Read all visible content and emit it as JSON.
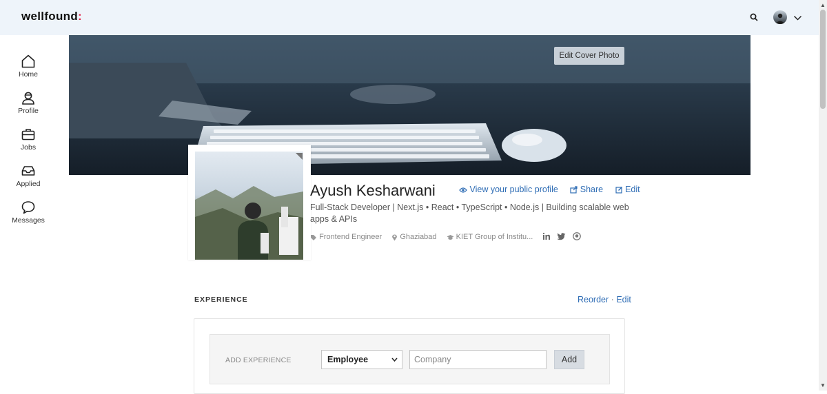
{
  "header": {
    "logo_text": "wellfound",
    "logo_accent": ":",
    "accent_color": "#e0264a",
    "icons": [
      "search-icon",
      "avatar",
      "chevron-down-icon"
    ]
  },
  "sidebar": {
    "items": [
      {
        "label": "Home",
        "icon": "home-icon"
      },
      {
        "label": "Profile",
        "icon": "user-icon"
      },
      {
        "label": "Jobs",
        "icon": "briefcase-icon"
      },
      {
        "label": "Applied",
        "icon": "inbox-icon"
      },
      {
        "label": "Messages",
        "icon": "chat-bubble-icon"
      }
    ]
  },
  "cover": {
    "edit_label": "Edit Cover Photo"
  },
  "profile": {
    "name": "Ayush Kesharwani",
    "view_public": "View your public profile",
    "share": "Share",
    "edit": "Edit",
    "headline": "Full-Stack Developer | Next.js • React • TypeScript • Node.js | Building scalable web apps & APIs",
    "role": "Frontend Engineer",
    "location": "Ghaziabad",
    "education": "KIET Group of Institu...",
    "social_icons": [
      "linkedin-icon",
      "twitter-icon",
      "github-icon"
    ],
    "link_color": "#2f6db5"
  },
  "experience": {
    "title": "EXPERIENCE",
    "reorder": "Reorder",
    "separator": "·",
    "edit": "Edit",
    "add_label": "ADD EXPERIENCE",
    "employment_type": "Employee",
    "company_placeholder": "Company",
    "add_button": "Add"
  }
}
